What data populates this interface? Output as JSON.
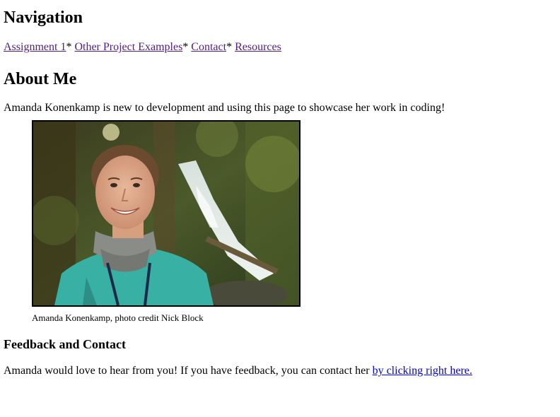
{
  "navigation": {
    "heading": "Navigation",
    "links": [
      {
        "label": "Assignment 1"
      },
      {
        "label": "Other Project Examples"
      },
      {
        "label": "Contact"
      },
      {
        "label": "Resources"
      }
    ],
    "separator": "*"
  },
  "about": {
    "heading": "About Me",
    "intro": "Amanda Konenkamp is new to development and using this page to showcase her work in coding!",
    "caption": "Amanda Konenkamp, photo credit Nick Block"
  },
  "feedback": {
    "heading": "Feedback and Contact",
    "text": "Amanda would love to hear from you! If you have feedback, you can contact her ",
    "link_label": "by clicking right here."
  },
  "colors": {
    "visited_link": "#551a8b",
    "link": "#0000ee"
  }
}
